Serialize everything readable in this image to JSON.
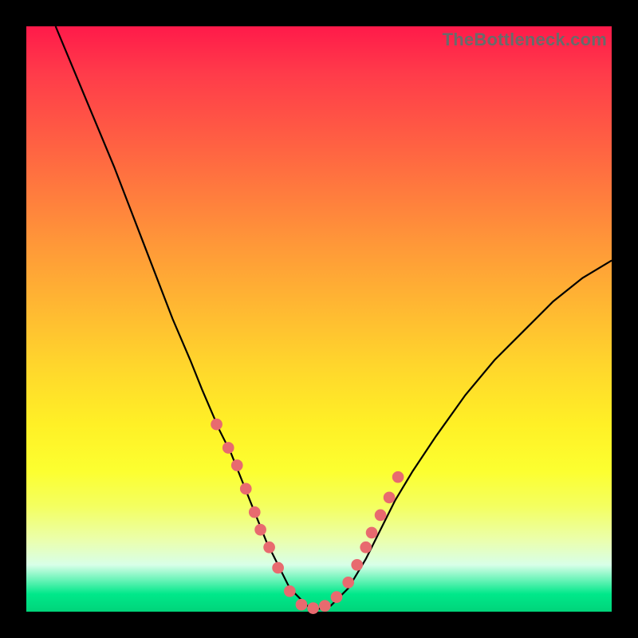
{
  "watermark": "TheBottleneck.com",
  "chart_data": {
    "type": "line",
    "title": "",
    "xlabel": "",
    "ylabel": "",
    "xlim": [
      0,
      100
    ],
    "ylim": [
      0,
      100
    ],
    "series": [
      {
        "name": "curve",
        "x": [
          5,
          10,
          15,
          20,
          25,
          28,
          30,
          33,
          35,
          37,
          39,
          41,
          43,
          45,
          48,
          50,
          52,
          55,
          58,
          60,
          63,
          66,
          70,
          75,
          80,
          85,
          90,
          95,
          100
        ],
        "y": [
          100,
          88,
          76,
          63,
          50,
          43,
          38,
          31,
          27,
          22,
          17,
          12,
          8,
          4,
          1,
          0.5,
          1,
          4,
          9,
          13,
          19,
          24,
          30,
          37,
          43,
          48,
          53,
          57,
          60
        ]
      }
    ],
    "markers": {
      "name": "scatter-dots",
      "x": [
        32.5,
        34.5,
        36,
        37.5,
        39,
        40,
        41.5,
        43,
        45,
        47,
        49,
        51,
        53,
        55,
        56.5,
        58,
        59,
        60.5,
        62,
        63.5
      ],
      "y": [
        32,
        28,
        25,
        21,
        17,
        14,
        11,
        7.5,
        3.5,
        1.2,
        0.6,
        1,
        2.5,
        5,
        8,
        11,
        13.5,
        16.5,
        19.5,
        23
      ],
      "radius": 1.0
    },
    "colors": {
      "curve": "#000000",
      "dots": "#e86a6f",
      "gradient_top": "#ff1a4a",
      "gradient_mid": "#ffd62c",
      "gradient_bottom": "#00d47a",
      "frame": "#000000"
    }
  }
}
